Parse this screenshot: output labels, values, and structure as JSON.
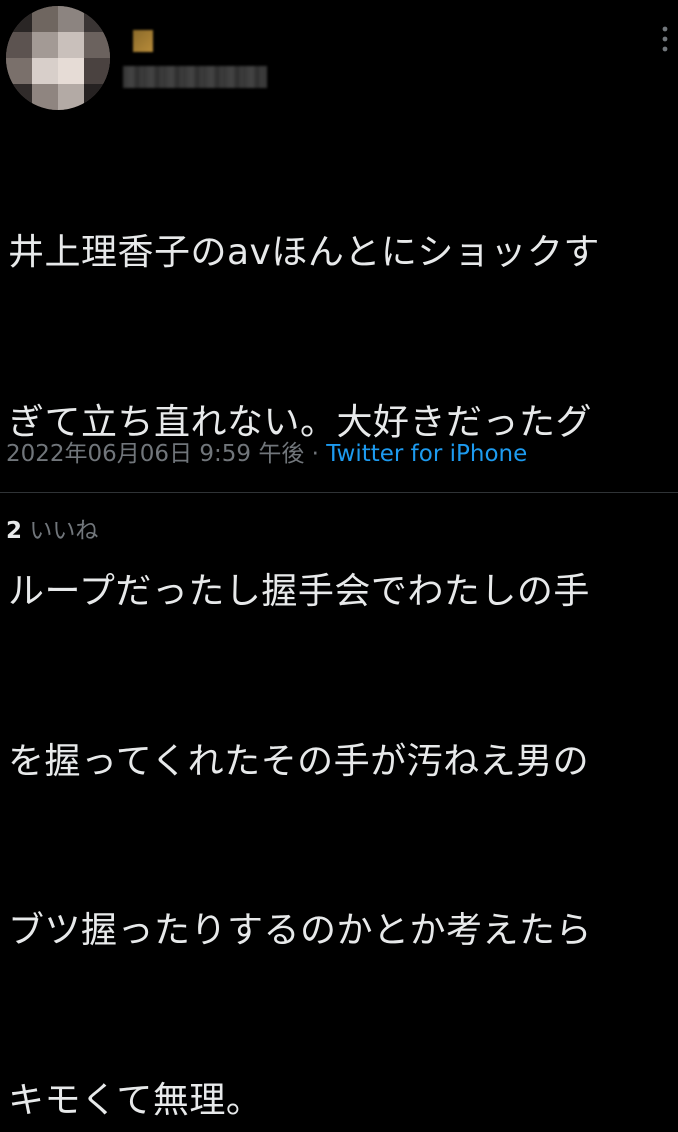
{
  "tweet": {
    "avatar_icon": "profile-avatar (pixelated)",
    "more_icon": "more-vertical-icon",
    "lines": [
      "井上理香子のavほんとにショックす",
      "ぎて立ち直れない。大好きだったグ",
      "ループだったし握手会でわたしの手",
      "を握ってくれたその手が汚ねえ男の",
      "ブツ握ったりするのかとか考えたら",
      "キモくて無理。"
    ],
    "timestamp": "2022年06月06日 9:59 午後",
    "separator": " · ",
    "source": "Twitter for iPhone",
    "likes_count": "2",
    "likes_label": "いいね"
  },
  "colors": {
    "background": "#000000",
    "text": "#e7e9ea",
    "muted": "#71767b",
    "link": "#1d9bf0",
    "divider": "#2f3336"
  }
}
